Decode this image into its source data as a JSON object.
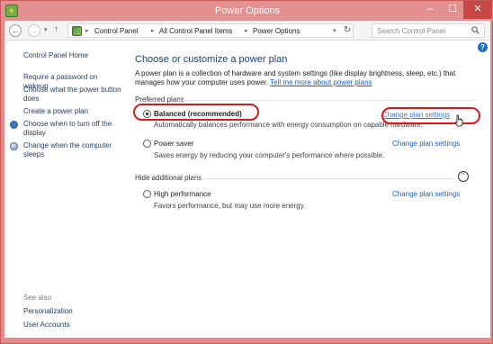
{
  "window": {
    "title": "Power Options",
    "controls": {
      "minimize": "–",
      "maximize": "☐",
      "close": "✕"
    }
  },
  "addressbar": {
    "breadcrumbs": [
      "Control Panel",
      "All Control Panel Items",
      "Power Options"
    ],
    "search_placeholder": "Search Control Panel"
  },
  "sidebar": {
    "home": "Control Panel Home",
    "items": [
      {
        "label": "Require a password on wakeup"
      },
      {
        "label": "Choose what the power button does"
      },
      {
        "label": "Create a power plan"
      },
      {
        "label": "Choose when to turn off the display",
        "icon": "power-shield-icon"
      },
      {
        "label": "Change when the computer sleeps",
        "icon": "moon-icon"
      }
    ],
    "see_also": {
      "heading": "See also",
      "items": [
        "Personalization",
        "User Accounts"
      ]
    }
  },
  "main": {
    "title": "Choose or customize a power plan",
    "intro": "A power plan is a collection of hardware and system settings (like display brightness, sleep, etc.) that manages how your computer uses power.",
    "intro_link": "Tell me more about power plans",
    "preferred_label": "Preferred plans",
    "hide_label": "Hide additional plans",
    "plans": [
      {
        "name": "Balanced (recommended)",
        "description": "Automatically balances performance with energy consumption on capable hardware.",
        "link": "Change plan settings",
        "selected": true
      },
      {
        "name": "Power saver",
        "description": "Saves energy by reducing your computer's performance where possible.",
        "link": "Change plan settings",
        "selected": false
      },
      {
        "name": "High performance",
        "description": "Favors performance, but may use more energy.",
        "link": "Change plan settings",
        "selected": false
      }
    ]
  },
  "colors": {
    "titlebar": "#e39090",
    "link": "#1660c8",
    "heading": "#1e3f73",
    "annotation": "#d41a1a"
  }
}
